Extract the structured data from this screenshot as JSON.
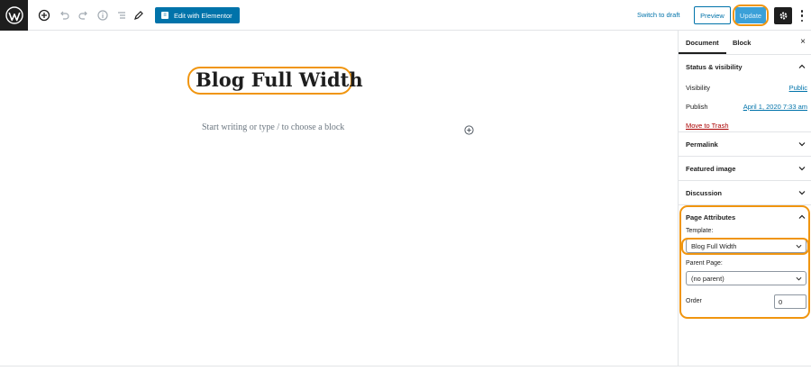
{
  "topbar": {
    "elementor_label": "Edit with Elementor",
    "switch_draft": "Switch to draft",
    "preview": "Preview",
    "update": "Update"
  },
  "editor": {
    "title": "Blog Full Width",
    "placeholder": "Start writing or type / to choose a block"
  },
  "sidebar": {
    "tabs": [
      "Document",
      "Block"
    ],
    "close": "×",
    "status": {
      "heading": "Status & visibility",
      "visibility_label": "Visibility",
      "visibility_value": "Public",
      "publish_label": "Publish",
      "publish_value": "April 1, 2020 7:33 am",
      "trash": "Move to Trash"
    },
    "panels": [
      "Permalink",
      "Featured image",
      "Discussion"
    ],
    "attributes": {
      "heading": "Page Attributes",
      "template_label": "Template:",
      "template_value": "Blog Full Width",
      "parent_label": "Parent Page:",
      "parent_value": "(no parent)",
      "order_label": "Order",
      "order_value": "0"
    }
  },
  "colors": {
    "accent": "#0073aa",
    "highlight": "#f0950f",
    "trash": "#aa0000"
  }
}
